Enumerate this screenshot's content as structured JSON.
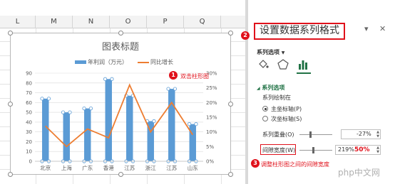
{
  "columns": [
    "L",
    "M",
    "N",
    "O",
    "P",
    "Q"
  ],
  "chart": {
    "title": "图表标题",
    "legend": {
      "bar": "年利润（万元）",
      "line": "同比增长"
    }
  },
  "chart_data": {
    "type": "bar",
    "title": "图表标题",
    "categories": [
      "北京",
      "上海",
      "广东",
      "香港",
      "江苏",
      "浙江",
      "江苏",
      "山东"
    ],
    "series": [
      {
        "name": "年利润（万元）",
        "type": "bar",
        "axis": "left",
        "values": [
          64,
          50,
          54,
          84,
          67,
          41,
          74,
          38
        ]
      },
      {
        "name": "同比增长",
        "type": "line",
        "axis": "right",
        "values": [
          0.12,
          0.05,
          0.11,
          0.08,
          0.26,
          0.1,
          0.2,
          0.09
        ]
      }
    ],
    "ylim": [
      0,
      90
    ],
    "y_ticks": [
      "0",
      "10",
      "20",
      "30",
      "40",
      "50",
      "60",
      "70",
      "80",
      "90"
    ],
    "y2lim": [
      0,
      0.3
    ],
    "y2_ticks": [
      "0%",
      "5%",
      "10%",
      "15%",
      "20%",
      "25%",
      "30%"
    ],
    "colors": {
      "bar": "#5b9bd5",
      "line": "#ed7d31"
    },
    "legend_position": "top"
  },
  "annotations": [
    {
      "number": "1",
      "text": "双击柱形图"
    },
    {
      "number": "2",
      "text": ""
    },
    {
      "number": "3",
      "text": "调整柱形图之间的间隙宽度"
    }
  ],
  "pane": {
    "title": "设置数据系列格式",
    "options_label": "系列选项",
    "options_arrow": "▼",
    "section": "系列选项",
    "plot_on": "系列绘制在",
    "primary_axis": "主坐标轴(P)",
    "secondary_axis": "次坐标轴(S)",
    "overlap_label": "系列重叠(O)",
    "overlap_value": "-27%",
    "gap_label": "间隙宽度(W)",
    "gap_value": "219%",
    "gap_highlight": "50%",
    "primary_selected": true
  },
  "watermark": "php中文网"
}
